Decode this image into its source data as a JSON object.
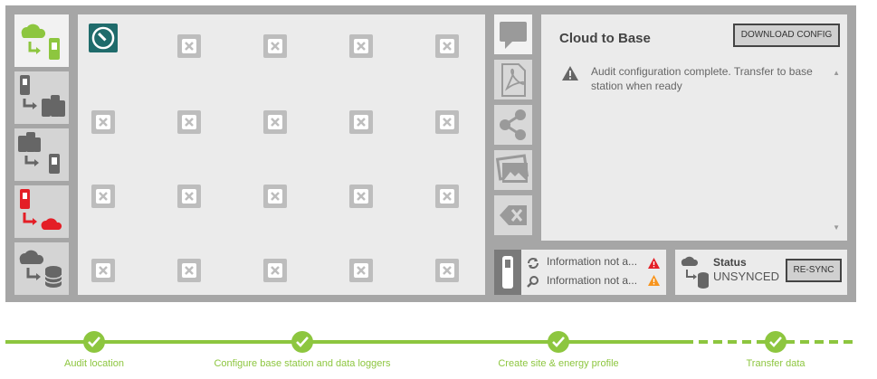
{
  "grid": {
    "rows": 4,
    "cols": 5
  },
  "panel": {
    "title": "Cloud to Base",
    "download_label": "DOWNLOAD CONFIG",
    "message": "Audit configuration complete. Transfer to base station when ready",
    "scroll_up": "▲",
    "scroll_down": "▼"
  },
  "info": {
    "row1": "Information not a...",
    "row2": "Information not a..."
  },
  "status": {
    "label": "Status",
    "value": "UNSYNCED",
    "resync_label": "RE-SYNC"
  },
  "steps": [
    {
      "label": "Audit location",
      "complete": true
    },
    {
      "label": "Configure base station and data loggers",
      "complete": true
    },
    {
      "label": "Create site & energy profile",
      "complete": true
    },
    {
      "label": "Transfer data",
      "complete": true
    }
  ],
  "colors": {
    "accent_green": "#8dc63f",
    "alert_red": "#e41e26",
    "warning_orange": "#f7941d",
    "teal": "#1f6b6b"
  }
}
